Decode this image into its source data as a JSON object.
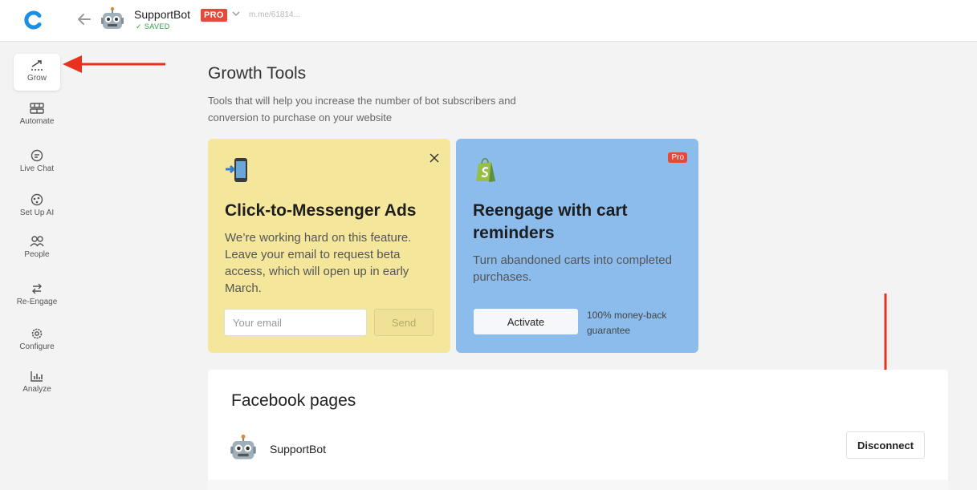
{
  "header": {
    "bot_name": "SupportBot",
    "pro_label": "PRO",
    "url": "m.me/61814...",
    "saved_label": "SAVED"
  },
  "sidebar": {
    "items": [
      {
        "label": "Grow",
        "icon": "grow-icon"
      },
      {
        "label": "Automate",
        "icon": "automate-icon"
      },
      {
        "label": "Live Chat",
        "icon": "chat-icon"
      },
      {
        "label": "Set Up AI",
        "icon": "ai-icon"
      },
      {
        "label": "People",
        "icon": "people-icon"
      },
      {
        "label": "Re-Engage",
        "icon": "reengage-icon"
      },
      {
        "label": "Configure",
        "icon": "gear-icon"
      },
      {
        "label": "Analyze",
        "icon": "analytics-icon"
      }
    ]
  },
  "main": {
    "title": "Growth Tools",
    "subtitle": "Tools that will help you increase the number of bot subscribers and conversion to purchase on your website"
  },
  "cards": {
    "messenger": {
      "title": "Click-to-Messenger Ads",
      "text": "We’re working hard on this feature. Leave your email to request beta access, which will open up in early March.",
      "email_placeholder": "Your email",
      "send_label": "Send"
    },
    "cart": {
      "pro_label": "Pro",
      "title": "Reengage with cart reminders",
      "text": "Turn abandoned carts into completed purchases.",
      "activate_label": "Activate",
      "guarantee": "100% money-back guarantee"
    }
  },
  "facebook": {
    "title": "Facebook pages",
    "page_name": "SupportBot",
    "disconnect_label": "Disconnect"
  },
  "colors": {
    "accent": "#1a8fe3",
    "pro": "#e4493a",
    "yellow_card": "#f4e79c",
    "blue_card": "#8cbcec",
    "arrow": "#e8321f"
  }
}
